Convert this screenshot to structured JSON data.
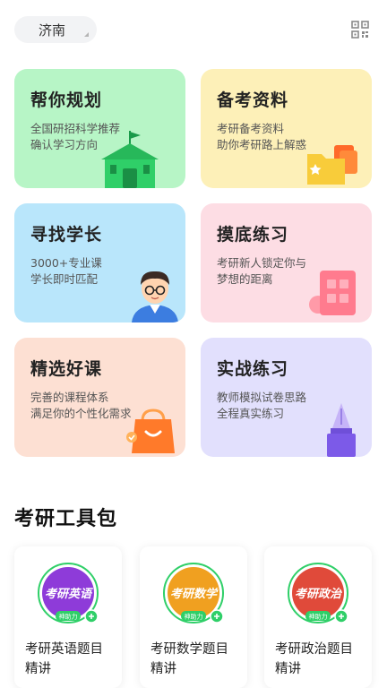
{
  "header": {
    "city": "济南",
    "scan_icon": "qr-scan-icon"
  },
  "cards": [
    {
      "title": "帮你规划",
      "desc1": "全国研招科学推荐",
      "desc2": "确认学习方向",
      "icon": "school-building-icon",
      "bg": "#b7f5c6"
    },
    {
      "title": "备考资料",
      "desc1": "考研备考资料",
      "desc2": "助你考研路上解惑",
      "icon": "folder-files-icon",
      "bg": "#fdf0b8"
    },
    {
      "title": "寻找学长",
      "desc1": "3000+专业课",
      "desc2": "学长即时匹配",
      "icon": "senior-avatar-icon",
      "bg": "#b9e6fb"
    },
    {
      "title": "摸底练习",
      "desc1": "考研新人锁定你与",
      "desc2": "梦想的距离",
      "icon": "test-paper-icon",
      "bg": "#fddde4"
    },
    {
      "title": "精选好课",
      "desc1": "完善的课程体系",
      "desc2": "满足你的个性化需求",
      "icon": "shopping-bag-icon",
      "bg": "#fde0d3"
    },
    {
      "title": "实战练习",
      "desc1": "教师模拟试卷思路",
      "desc2": "全程真实练习",
      "icon": "fountain-pen-icon",
      "bg": "#e2e0fd"
    }
  ],
  "toolkit": {
    "title": "考研工具包",
    "items": [
      {
        "badge": "考研英语",
        "name1": "考研英语题目",
        "name2": "精讲",
        "color": "#8e3bd9",
        "badge_tag": "神助力"
      },
      {
        "badge": "考研数学",
        "name1": "考研数学题目",
        "name2": "精讲",
        "color": "#f0a020",
        "badge_tag": "神助力"
      },
      {
        "badge": "考研政治",
        "name1": "考研政治题目",
        "name2": "精讲",
        "color": "#e04a3a",
        "badge_tag": "神助力"
      }
    ]
  }
}
